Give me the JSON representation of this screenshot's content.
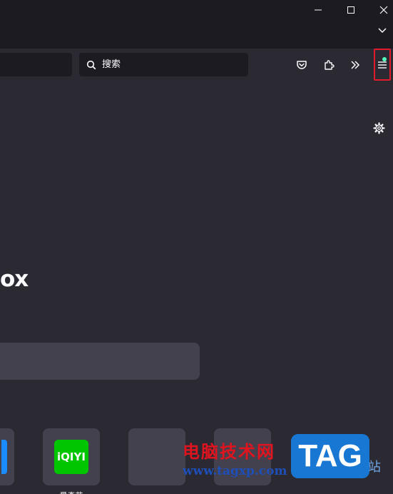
{
  "window": {
    "icons": [
      "minimize-icon",
      "maximize-icon",
      "close-icon",
      "chevron-down-icon"
    ]
  },
  "navbar": {
    "search_placeholder": "搜索",
    "icons": [
      "search-icon",
      "pocket-icon",
      "extensions-icon",
      "overflow-chevron-icon",
      "hamburger-menu-icon"
    ],
    "highlight_color": "#e21b2c",
    "notification_dot_color": "#54ffbd"
  },
  "content": {
    "brand_text": "ox",
    "tiles": [
      {
        "name": "partial-tile"
      },
      {
        "name": "iqiyi",
        "logo_text": "iQIYI",
        "label": "爱奇艺",
        "logo_color": "#00c500"
      },
      {
        "name": "empty-tile"
      },
      {
        "name": "empty-tile"
      }
    ]
  },
  "watermark": {
    "chinese_text": "电脑技术网",
    "url_text": "www.tagxp.com",
    "logo_text": "TAG",
    "side_text": "站"
  },
  "colors": {
    "titlebar": "#1c1b22",
    "toolbar": "#2b2a33",
    "field": "#1c1b22",
    "tile": "#42414d",
    "text": "#fbfbfe"
  }
}
